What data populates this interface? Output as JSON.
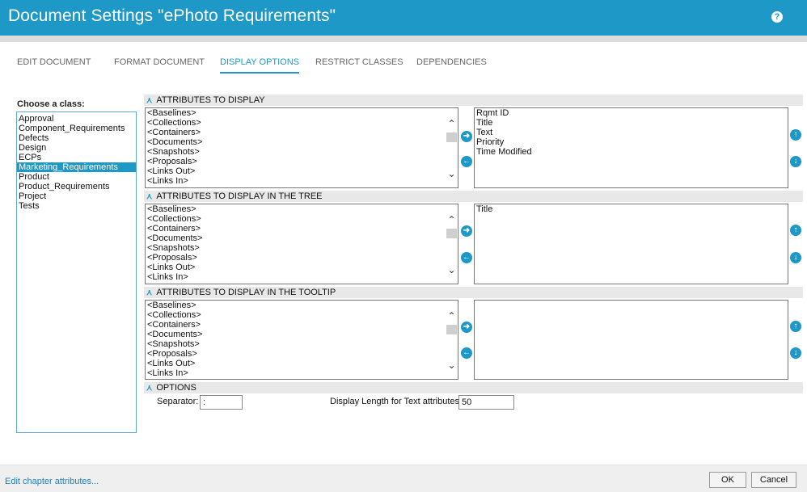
{
  "window": {
    "title": "Document Settings \"ePhoto Requirements\"",
    "help_icon": "?"
  },
  "tabs": [
    {
      "label": "EDIT DOCUMENT"
    },
    {
      "label": "FORMAT DOCUMENT"
    },
    {
      "label": "DISPLAY OPTIONS",
      "active": true
    },
    {
      "label": "RESTRICT CLASSES"
    },
    {
      "label": "DEPENDENCIES"
    }
  ],
  "class_chooser": {
    "label": "Choose a class:",
    "items": [
      "Approval",
      "Component_Requirements",
      "Defects",
      "Design",
      "ECPs",
      "Marketing_Requirements",
      "Product",
      "Product_Requirements",
      "Project",
      "Tests"
    ],
    "selected": "Marketing_Requirements"
  },
  "available_items": [
    "<Baselines>",
    "<Collections>",
    "<Containers>",
    "<Documents>",
    "<Snapshots>",
    "<Proposals>",
    "<Links Out>",
    "<Links In>"
  ],
  "sections": {
    "display": {
      "title": "ATTRIBUTES TO DISPLAY",
      "selected": [
        "Rqmt ID",
        "Title",
        "Text",
        "Priority",
        "Time Modified"
      ]
    },
    "tree": {
      "title": "ATTRIBUTES TO DISPLAY IN THE TREE",
      "selected": [
        "Title"
      ]
    },
    "tooltip": {
      "title": "ATTRIBUTES TO DISPLAY IN THE TOOLTIP",
      "selected": []
    },
    "options": {
      "title": "OPTIONS"
    }
  },
  "options": {
    "separator_label": "Separator:",
    "separator_value": ":",
    "length_label": "Display Length for Text attributes:",
    "length_value": "50"
  },
  "footer": {
    "link": "Edit chapter attributes...",
    "ok": "OK",
    "cancel": "Cancel"
  },
  "icons": {
    "move_right": "arrow-right-icon",
    "move_left": "arrow-left-icon",
    "move_up": "arrow-up-icon",
    "move_down": "arrow-down-icon",
    "collapse": "double-chevron-down-icon"
  },
  "colors": {
    "accent": "#1e98c7"
  }
}
